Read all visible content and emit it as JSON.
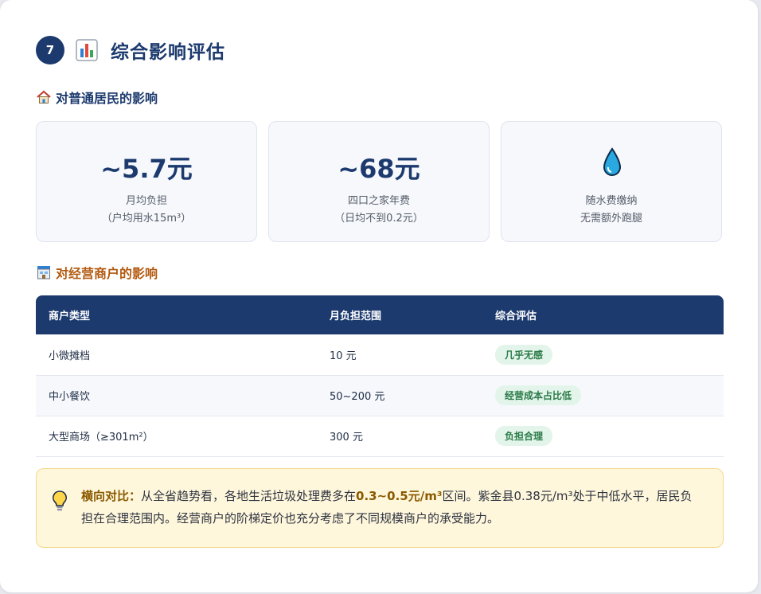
{
  "section": {
    "number": "7",
    "title": "综合影响评估",
    "icon": "bar-chart-icon"
  },
  "residents": {
    "heading": "对普通居民的影响",
    "icon": "house-icon",
    "cards": [
      {
        "value": "~5.7元",
        "line1": "月均负担",
        "line2": "（户均用水15m³）"
      },
      {
        "value": "~68元",
        "line1": "四口之家年费",
        "line2": "（日均不到0.2元）"
      },
      {
        "icon": "water-drop-icon",
        "line1": "随水费缴纳",
        "line2": "无需额外跑腿"
      }
    ]
  },
  "merchants": {
    "heading": "对经营商户的影响",
    "icon": "shop-icon",
    "columns": [
      "商户类型",
      "月负担范围",
      "综合评估"
    ],
    "rows": [
      {
        "type": "小微摊档",
        "range": "10 元",
        "eval": "几乎无感"
      },
      {
        "type": "中小餐饮",
        "range": "50~200 元",
        "eval": "经营成本占比低"
      },
      {
        "type": "大型商场（≥301m²）",
        "range": "300 元",
        "eval": "负担合理"
      }
    ]
  },
  "note": {
    "icon": "lightbulb-icon",
    "lead": "横向对比：",
    "text1": "从全省趋势看，各地生活垃圾处理费多在",
    "highlight": "0.3~0.5元/m³",
    "text2": "区间。紫金县0.38元/m³处于中低水平，居民负担在合理范围内。经营商户的阶梯定价也充分考虑了不同规模商户的承受能力。"
  },
  "colors": {
    "primary": "#1c3a6e",
    "accent_orange": "#b25a10",
    "badge_bg": "#e3f5ea",
    "badge_text": "#2a7a48",
    "note_bg": "#fff7dc"
  }
}
